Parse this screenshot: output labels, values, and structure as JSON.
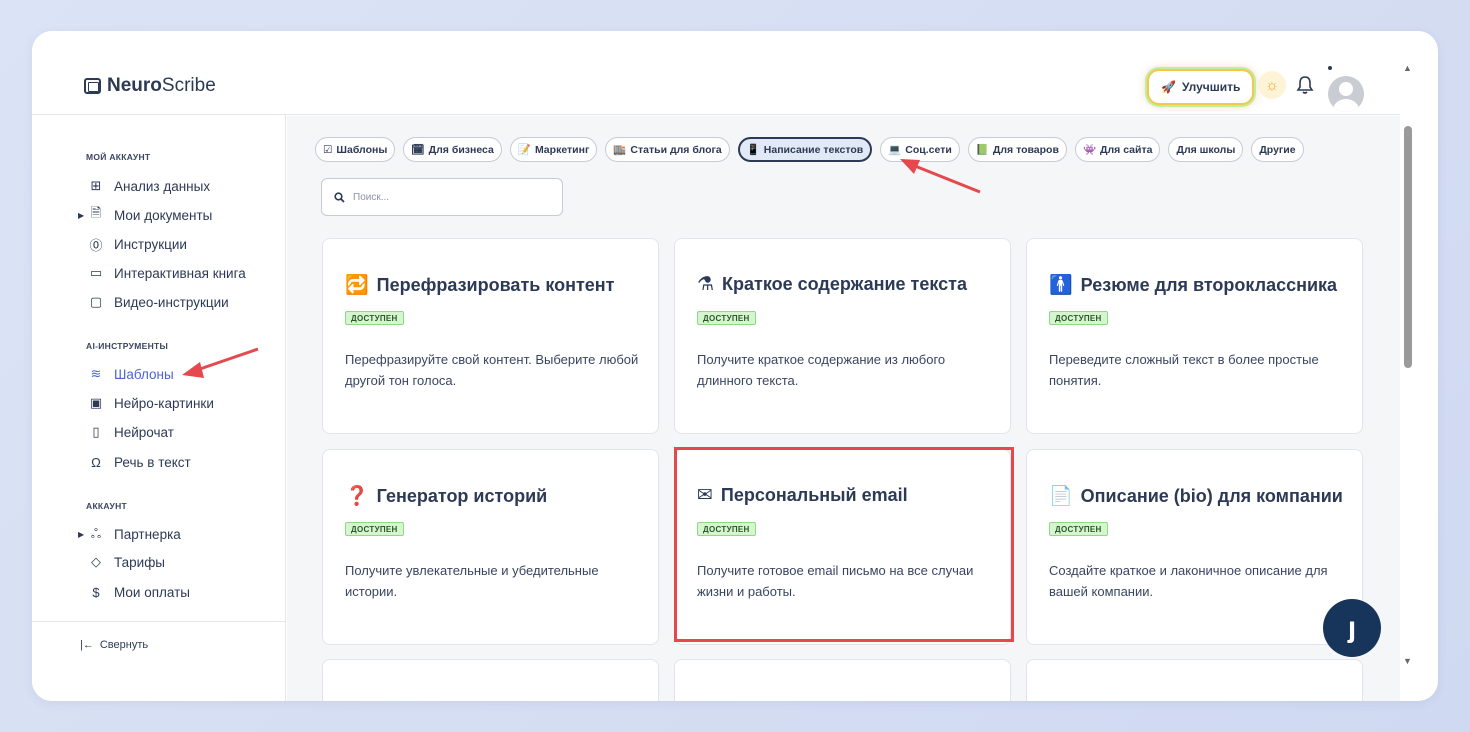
{
  "app": {
    "logo_bold": "Neuro",
    "logo_rest": "Scribe"
  },
  "topbar": {
    "upgrade_label": "Улучшить"
  },
  "sidebar": {
    "section_account": "МОЙ АККАУНТ",
    "section_ai": "AI-ИНСТРУМЕНТЫ",
    "section_acc2": "АККАУНТ",
    "items": [
      {
        "label": "Анализ данных",
        "icon": "grid-icon"
      },
      {
        "label": "Мои документы",
        "icon": "document-icon"
      },
      {
        "label": "Инструкции",
        "icon": "help-icon"
      },
      {
        "label": "Интерактивная книга",
        "icon": "book-icon"
      },
      {
        "label": "Видео-инструкции",
        "icon": "video-icon"
      },
      {
        "label": "Шаблоны",
        "icon": "layers-icon"
      },
      {
        "label": "Нейро-картинки",
        "icon": "image-icon"
      },
      {
        "label": "Нейрочат",
        "icon": "chat-icon"
      },
      {
        "label": "Речь в текст",
        "icon": "headphones-icon"
      },
      {
        "label": "Партнерка",
        "icon": "users-icon"
      },
      {
        "label": "Тарифы",
        "icon": "tag-icon"
      },
      {
        "label": "Мои оплаты",
        "icon": "dollar-icon"
      }
    ],
    "collapse_label": "Свернуть"
  },
  "categories": [
    {
      "label": "Шаблоны",
      "icon": "☑"
    },
    {
      "label": "Для бизнеса",
      "icon": "🗓"
    },
    {
      "label": "Маркетинг",
      "icon": "📝"
    },
    {
      "label": "Статьи для блога",
      "icon": "🏬"
    },
    {
      "label": "Написание текстов",
      "icon": "📱"
    },
    {
      "label": "Соц.сети",
      "icon": "💻"
    },
    {
      "label": "Для товаров",
      "icon": "📗"
    },
    {
      "label": "Для сайта",
      "icon": "👾"
    },
    {
      "label": "Для школы",
      "icon": ""
    },
    {
      "label": "Другие",
      "icon": ""
    }
  ],
  "search": {
    "placeholder": "Поиск..."
  },
  "cards": [
    {
      "title": "Перефразировать контент",
      "emoji": "🔁",
      "badge": "ДОСТУПЕН",
      "desc": "Перефразируйте свой контент. Выберите любой другой тон голоса."
    },
    {
      "title": "Краткое содержание текста",
      "emoji": "⚗",
      "badge": "ДОСТУПЕН",
      "desc": "Получите краткое содержание из любого длинного текста."
    },
    {
      "title": "Резюме для второклассника",
      "emoji": "🚹",
      "badge": "ДОСТУПЕН",
      "desc": "Переведите сложный текст в более простые понятия."
    },
    {
      "title": "Генератор историй",
      "emoji": "❓",
      "badge": "ДОСТУПЕН",
      "desc": "Получите увлекательные и убедительные истории."
    },
    {
      "title": "Персональный email",
      "emoji": "✉",
      "badge": "ДОСТУПЕН",
      "desc": "Получите готовое email письмо на все случаи жизни и работы."
    },
    {
      "title": "Описание (bio) для компании",
      "emoji": "📄",
      "badge": "ДОСТУПЕН",
      "desc": "Создайте краткое и лаконичное описание для вашей компании."
    }
  ]
}
